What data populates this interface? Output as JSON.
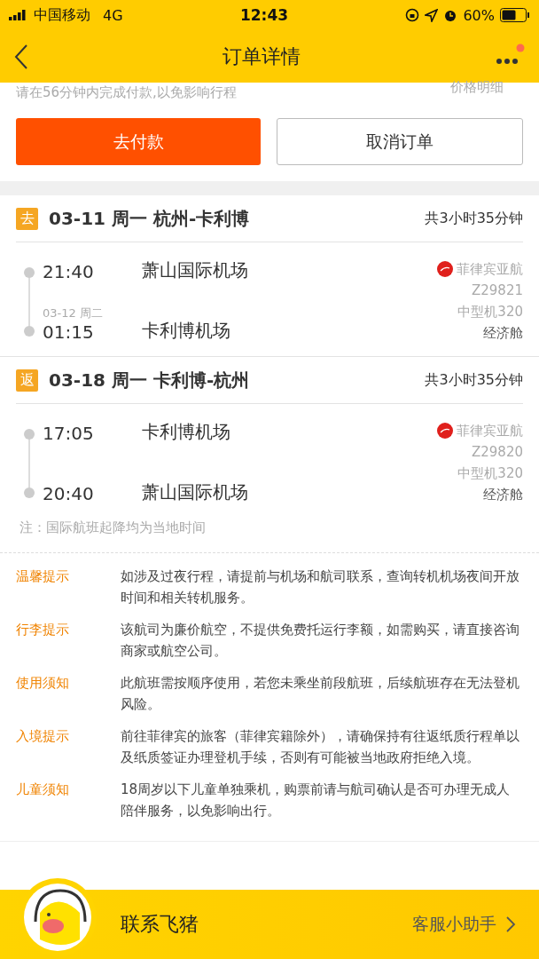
{
  "status_bar": {
    "carrier": "中国移动",
    "network": "4G",
    "time": "12:43",
    "battery": "60%"
  },
  "nav": {
    "title": "订单详情",
    "has_notification": true
  },
  "payment": {
    "hint": "请在56分钟内完成付款,以免影响行程",
    "price_link": "价格明细",
    "pay_button": "去付款",
    "cancel_button": "取消订单"
  },
  "legs": [
    {
      "tag": "去",
      "title": "03-11 周一 杭州-卡利博",
      "duration": "共3小时35分钟",
      "depart_time": "21:40",
      "depart_airport": "萧山国际机场",
      "arrive_date": "03-12 周二",
      "arrive_time": "01:15",
      "arrive_airport": "卡利博机场",
      "airline": "菲律宾亚航",
      "flight_no": "Z29821",
      "aircraft": "中型机320",
      "cabin": "经济舱"
    },
    {
      "tag": "返",
      "title": "03-18 周一 卡利博-杭州",
      "duration": "共3小时35分钟",
      "depart_time": "17:05",
      "depart_airport": "卡利博机场",
      "arrive_time": "20:40",
      "arrive_airport": "萧山国际机场",
      "airline": "菲律宾亚航",
      "flight_no": "Z29820",
      "aircraft": "中型机320",
      "cabin": "经济舱"
    }
  ],
  "note": "注：国际航班起降均为当地时间",
  "tips": [
    {
      "label": "温馨提示",
      "text": "如涉及过夜行程，请提前与机场和航司联系，查询转机机场夜间开放时间和相关转机服务。"
    },
    {
      "label": "行李提示",
      "text": "该航司为廉价航空，不提供免费托运行李额，如需购买，请直接咨询商家或航空公司。"
    },
    {
      "label": "使用须知",
      "text": "此航班需按顺序使用，若您未乘坐前段航班，后续航班存在无法登机风险。"
    },
    {
      "label": "入境提示",
      "text": "前往菲律宾的旅客（菲律宾籍除外），请确保持有往返纸质行程单以及纸质签证办理登机手续，否则有可能被当地政府拒绝入境。"
    },
    {
      "label": "儿童须知",
      "text": "18周岁以下儿童单独乘机，购票前请与航司确认是否可办理无成人陪伴服务，以免影响出行。"
    }
  ],
  "footer": {
    "contact": "联系飞猪",
    "assistant": "客服小助手"
  }
}
